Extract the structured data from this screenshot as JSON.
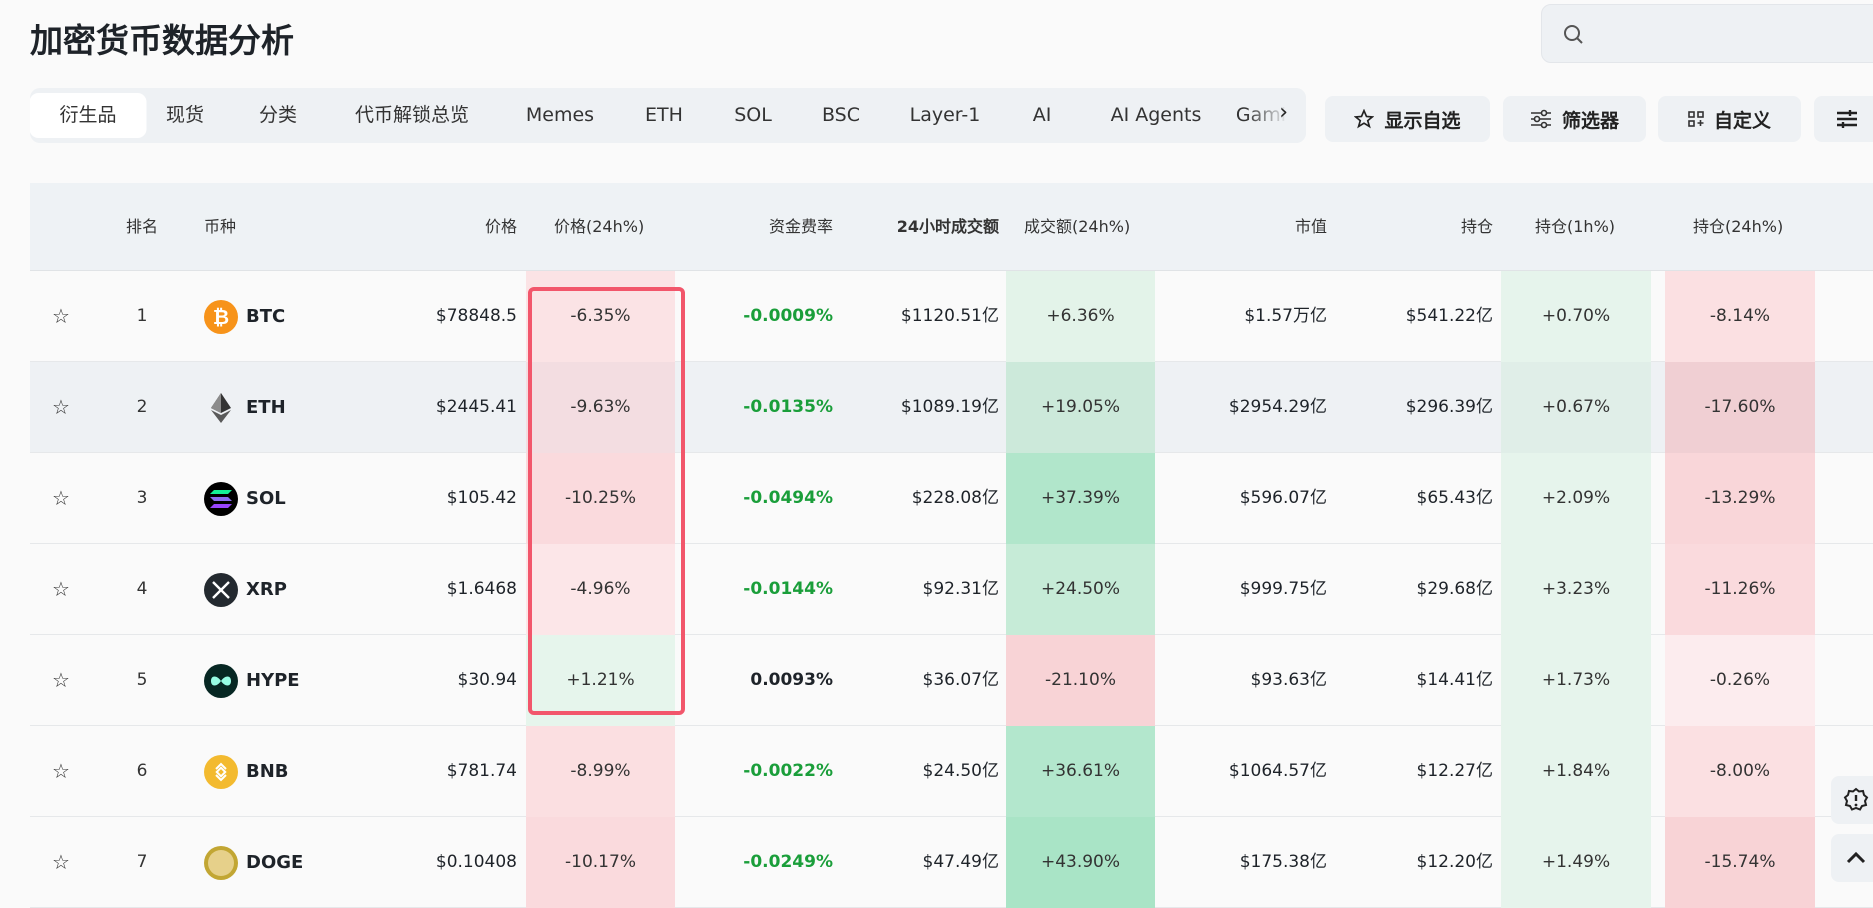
{
  "header": {
    "title": "加密货币数据分析",
    "search_placeholder": ""
  },
  "tabs": [
    {
      "label": "衍生品",
      "active": true
    },
    {
      "label": "现货"
    },
    {
      "label": "分类"
    },
    {
      "label": "代币解锁总览"
    },
    {
      "label": "Memes"
    },
    {
      "label": "ETH"
    },
    {
      "label": "SOL"
    },
    {
      "label": "BSC"
    },
    {
      "label": "Layer-1"
    },
    {
      "label": "AI"
    },
    {
      "label": "AI Agents"
    },
    {
      "label": "Gaming"
    }
  ],
  "toolbar": {
    "watchlist": "显示自选",
    "filter": "筛选器",
    "customize": "自定义"
  },
  "columns": {
    "rank": "排名",
    "coin": "币种",
    "price": "价格",
    "price_24h": "价格(24h%)",
    "funding": "资金费率",
    "vol_24h": "24小时成交额",
    "vol_change": "成交额(24h%)",
    "mcap": "市值",
    "oi": "持仓",
    "oi_1h": "持仓(1h%)",
    "oi_24h": "持仓(24h%)"
  },
  "rows": [
    {
      "rank": "1",
      "coin": "BTC",
      "icon": "bitcoin-icon",
      "price": "$78848.5",
      "price_24h": "-6.35%",
      "price_bg": "#fbe3e5",
      "funding": "-0.0009%",
      "funding_color": "#1a9e3a",
      "vol": "$1120.51亿",
      "vol_change": "+6.36%",
      "vol_bg": "#e3f3e9",
      "mcap": "$1.57万亿",
      "oi": "$541.22亿",
      "oi_1h": "+0.70%",
      "oi_1h_bg": "#e6f4ec",
      "oi_24h": "-8.14%",
      "oi_24h_bg": "#fbe0e2"
    },
    {
      "rank": "2",
      "coin": "ETH",
      "icon": "ethereum-icon",
      "price": "$2445.41",
      "price_24h": "-9.63%",
      "price_bg": "#f3dde1",
      "funding": "-0.0135%",
      "funding_color": "#1a9e3a",
      "vol": "$1089.19亿",
      "vol_change": "+19.05%",
      "vol_bg": "#cce9da",
      "mcap": "$2954.29亿",
      "oi": "$296.39亿",
      "oi_1h": "+0.67%",
      "oi_1h_bg": "#e0eee8",
      "oi_24h": "-17.60%",
      "oi_24h_bg": "#f0cfd3"
    },
    {
      "rank": "3",
      "coin": "SOL",
      "icon": "solana-icon",
      "price": "$105.42",
      "price_24h": "-10.25%",
      "price_bg": "#fadadd",
      "funding": "-0.0494%",
      "funding_color": "#1a9e3a",
      "vol": "$228.08亿",
      "vol_change": "+37.39%",
      "vol_bg": "#b1e6cb",
      "mcap": "$596.07亿",
      "oi": "$65.43亿",
      "oi_1h": "+2.09%",
      "oi_1h_bg": "#e6f4ec",
      "oi_24h": "-13.29%",
      "oi_24h_bg": "#f9d6d9"
    },
    {
      "rank": "4",
      "coin": "XRP",
      "icon": "xrp-icon",
      "price": "$1.6468",
      "price_24h": "-4.96%",
      "price_bg": "#fce6e8",
      "funding": "-0.0144%",
      "funding_color": "#1a9e3a",
      "vol": "$92.31亿",
      "vol_change": "+24.50%",
      "vol_bg": "#c6ebd7",
      "mcap": "$999.75亿",
      "oi": "$29.68亿",
      "oi_1h": "+3.23%",
      "oi_1h_bg": "#e6f4ec",
      "oi_24h": "-11.26%",
      "oi_24h_bg": "#fadadd"
    },
    {
      "rank": "5",
      "coin": "HYPE",
      "icon": "hyperliquid-icon",
      "price": "$30.94",
      "price_24h": "+1.21%",
      "price_bg": "#e6f5ec",
      "funding": "0.0093%",
      "funding_color": "#1e2329",
      "vol": "$36.07亿",
      "vol_change": "-21.10%",
      "vol_bg": "#f8d3d6",
      "mcap": "$93.63亿",
      "oi": "$14.41亿",
      "oi_1h": "+1.73%",
      "oi_1h_bg": "#e6f4ec",
      "oi_24h": "-0.26%",
      "oi_24h_bg": "#fcecee"
    },
    {
      "rank": "6",
      "coin": "BNB",
      "icon": "bnb-icon",
      "price": "$781.74",
      "price_24h": "-8.99%",
      "price_bg": "#fbdfe1",
      "funding": "-0.0022%",
      "funding_color": "#1a9e3a",
      "vol": "$24.50亿",
      "vol_change": "+36.61%",
      "vol_bg": "#b3e7cd",
      "mcap": "$1064.57亿",
      "oi": "$12.27亿",
      "oi_1h": "+1.84%",
      "oi_1h_bg": "#e6f4ec",
      "oi_24h": "-8.00%",
      "oi_24h_bg": "#fbe0e2"
    },
    {
      "rank": "7",
      "coin": "DOGE",
      "icon": "dogecoin-icon",
      "price": "$0.10408",
      "price_24h": "-10.17%",
      "price_bg": "#fadadd",
      "funding": "-0.0249%",
      "funding_color": "#1a9e3a",
      "vol": "$47.49亿",
      "vol_change": "+43.90%",
      "vol_bg": "#a9e4c6",
      "mcap": "$175.38亿",
      "oi": "$12.20亿",
      "oi_1h": "+1.49%",
      "oi_1h_bg": "#e6f4ec",
      "oi_24h": "-15.74%",
      "oi_24h_bg": "#f8d3d6"
    }
  ],
  "highlight_color": "#f2566b"
}
